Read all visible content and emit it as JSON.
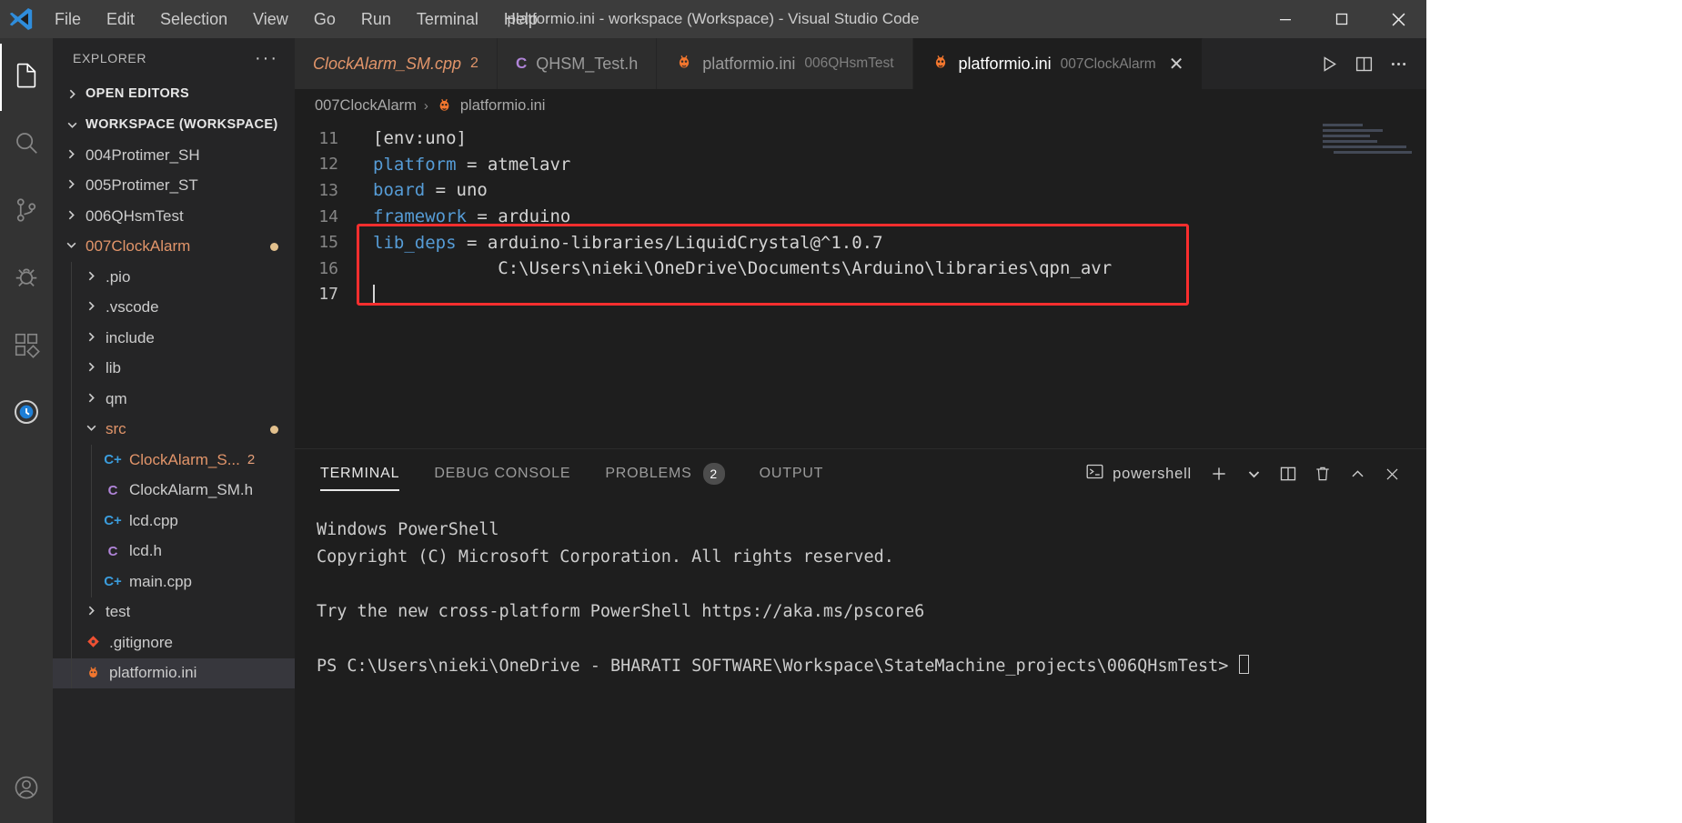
{
  "window": {
    "title": "platformio.ini - workspace (Workspace) - Visual Studio Code",
    "minimize": "─",
    "maximize": "☐",
    "close": "✕"
  },
  "menubar": {
    "items": [
      {
        "label": "File"
      },
      {
        "label": "Edit"
      },
      {
        "label": "Selection"
      },
      {
        "label": "View"
      },
      {
        "label": "Go"
      },
      {
        "label": "Run"
      },
      {
        "label": "Terminal"
      },
      {
        "label": "Help"
      }
    ]
  },
  "activitybar": {
    "items": [
      {
        "name": "explorer",
        "glyph": "files-icon",
        "active": true
      },
      {
        "name": "search",
        "glyph": "search-icon",
        "active": false
      },
      {
        "name": "source-control",
        "glyph": "source-control-icon",
        "active": false
      },
      {
        "name": "run-and-debug",
        "glyph": "debug-icon",
        "active": false
      },
      {
        "name": "extensions",
        "glyph": "extensions-icon",
        "active": false
      },
      {
        "name": "platformio",
        "glyph": "platformio-icon",
        "active": false
      }
    ],
    "bottom": [
      {
        "name": "accounts",
        "glyph": "account-icon"
      }
    ]
  },
  "sidebar": {
    "header_title": "EXPLORER",
    "more_actions": "···",
    "sections": [
      {
        "label": "OPEN EDITORS",
        "expanded": false
      },
      {
        "label": "WORKSPACE (WORKSPACE)",
        "expanded": true
      }
    ],
    "tree": [
      {
        "label": "004Protimer_SH",
        "type": "folder",
        "expanded": false,
        "indent": 1,
        "modified": false,
        "selected": false
      },
      {
        "label": "005Protimer_ST",
        "type": "folder",
        "expanded": false,
        "indent": 1,
        "modified": false,
        "selected": false
      },
      {
        "label": "006QHsmTest",
        "type": "folder",
        "expanded": false,
        "indent": 1,
        "modified": false,
        "selected": false
      },
      {
        "label": "007ClockAlarm",
        "type": "folder",
        "expanded": true,
        "indent": 1,
        "modified": true,
        "selected": false
      },
      {
        "label": ".pio",
        "type": "folder",
        "expanded": false,
        "indent": 2,
        "modified": false,
        "selected": false
      },
      {
        "label": ".vscode",
        "type": "folder",
        "expanded": false,
        "indent": 2,
        "modified": false,
        "selected": false
      },
      {
        "label": "include",
        "type": "folder",
        "expanded": false,
        "indent": 2,
        "modified": false,
        "selected": false
      },
      {
        "label": "lib",
        "type": "folder",
        "expanded": false,
        "indent": 2,
        "modified": false,
        "selected": false
      },
      {
        "label": "qm",
        "type": "folder",
        "expanded": false,
        "indent": 2,
        "modified": false,
        "selected": false
      },
      {
        "label": "src",
        "type": "folder",
        "expanded": true,
        "indent": 2,
        "modified": true,
        "selected": false
      },
      {
        "label": "ClockAlarm_S...",
        "type": "cpp",
        "icon": "C+",
        "indent": 3,
        "modified": true,
        "badge": "2",
        "selected": false
      },
      {
        "label": "ClockAlarm_SM.h",
        "type": "h",
        "icon": "C",
        "indent": 3,
        "modified": false,
        "selected": false
      },
      {
        "label": "lcd.cpp",
        "type": "cpp",
        "icon": "C+",
        "indent": 3,
        "modified": false,
        "selected": false
      },
      {
        "label": "lcd.h",
        "type": "h",
        "icon": "C",
        "indent": 3,
        "modified": false,
        "selected": false
      },
      {
        "label": "main.cpp",
        "type": "cpp",
        "icon": "C+",
        "indent": 3,
        "modified": false,
        "selected": false
      },
      {
        "label": "test",
        "type": "folder",
        "expanded": false,
        "indent": 2,
        "modified": false,
        "selected": false
      },
      {
        "label": ".gitignore",
        "type": "git",
        "icon": "◆",
        "indent": 2,
        "modified": false,
        "selected": false
      },
      {
        "label": "platformio.ini",
        "type": "ini",
        "icon": "🐜",
        "indent": 2,
        "modified": false,
        "selected": true
      }
    ]
  },
  "tabs": [
    {
      "name": "ClockAlarm_SM.cpp",
      "description": "",
      "badge": "2",
      "icon": "",
      "dirty": true,
      "active": false,
      "closable": false
    },
    {
      "name": "QHSM_Test.h",
      "description": "",
      "badge": "",
      "icon": "C",
      "icon_class": "c-h",
      "dirty": false,
      "active": false,
      "closable": false
    },
    {
      "name": "platformio.ini",
      "description": "006QHsmTest",
      "badge": "",
      "icon": "ant",
      "dirty": false,
      "active": false,
      "closable": false
    },
    {
      "name": "platformio.ini",
      "description": "007ClockAlarm",
      "badge": "",
      "icon": "ant",
      "dirty": false,
      "active": true,
      "closable": true,
      "close_glyph": "✕"
    }
  ],
  "editor_actions": [
    {
      "name": "run-button",
      "glyph": "▷"
    },
    {
      "name": "split-editor-button",
      "glyph": "◫"
    },
    {
      "name": "more-actions-button",
      "glyph": "···"
    }
  ],
  "breadcrumb": {
    "items": [
      "007ClockAlarm",
      "platformio.ini"
    ],
    "separator": "›"
  },
  "editor": {
    "filename": "platformio.ini",
    "highlight_color": "#fb2e2e",
    "lines": [
      {
        "num": "11",
        "tokens": [
          {
            "t": "[env:uno]",
            "c": "plain"
          }
        ]
      },
      {
        "num": "12",
        "tokens": [
          {
            "t": "platform",
            "c": "kw"
          },
          {
            "t": " = atmelavr",
            "c": "plain"
          }
        ]
      },
      {
        "num": "13",
        "tokens": [
          {
            "t": "board",
            "c": "kw"
          },
          {
            "t": " = uno",
            "c": "plain"
          }
        ]
      },
      {
        "num": "14",
        "tokens": [
          {
            "t": "framework",
            "c": "kw"
          },
          {
            "t": " = arduino",
            "c": "plain"
          }
        ]
      },
      {
        "num": "15",
        "tokens": [
          {
            "t": "lib_deps",
            "c": "kw"
          },
          {
            "t": " = arduino-libraries/LiquidCrystal@^1.0.7",
            "c": "plain"
          }
        ]
      },
      {
        "num": "16",
        "tokens": [
          {
            "t": "            C:\\Users\\nieki\\OneDrive\\Documents\\Arduino\\libraries\\qpn_avr",
            "c": "plain"
          }
        ]
      },
      {
        "num": "17",
        "tokens": [
          {
            "t": "",
            "c": "plain"
          }
        ],
        "caret": true
      }
    ]
  },
  "panel": {
    "tabs": [
      {
        "label": "TERMINAL",
        "count": "",
        "active": true
      },
      {
        "label": "DEBUG CONSOLE",
        "count": "",
        "active": false
      },
      {
        "label": "PROBLEMS",
        "count": "2",
        "active": false
      },
      {
        "label": "OUTPUT",
        "count": "",
        "active": false
      }
    ],
    "shell_name": "powershell",
    "shell_icon": "terminal-icon",
    "actions": [
      {
        "name": "new-terminal-button",
        "glyph": "＋"
      },
      {
        "name": "terminal-dropdown-button",
        "glyph": "⌄"
      },
      {
        "name": "split-terminal-button",
        "glyph": "◫"
      },
      {
        "name": "kill-terminal-button",
        "glyph": "🗑"
      },
      {
        "name": "maximize-panel-button",
        "glyph": "⌃"
      },
      {
        "name": "close-panel-button",
        "glyph": "✕"
      }
    ],
    "terminal_lines": [
      "Windows PowerShell",
      "Copyright (C) Microsoft Corporation. All rights reserved.",
      "",
      "Try the new cross-platform PowerShell https://aka.ms/pscore6",
      ""
    ],
    "prompt": "PS C:\\Users\\nieki\\OneDrive - BHARATI SOFTWARE\\Workspace\\StateMachine_projects\\006QHsmTest> "
  }
}
